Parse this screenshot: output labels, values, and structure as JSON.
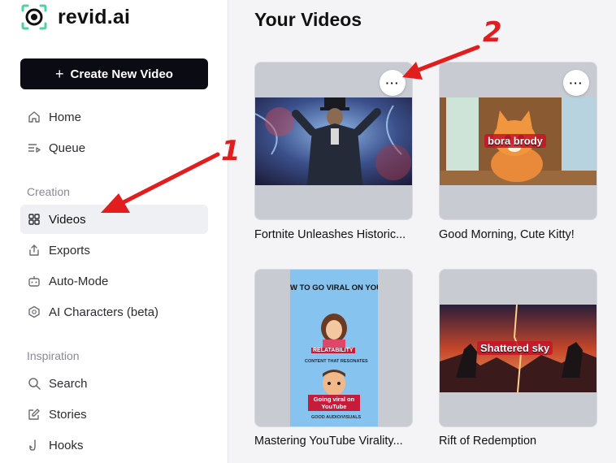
{
  "brand": {
    "name": "revid.ai"
  },
  "sidebar": {
    "create_label": "Create New Video",
    "items_top": [
      {
        "label": "Home",
        "icon": "home-icon"
      },
      {
        "label": "Queue",
        "icon": "queue-icon"
      }
    ],
    "section_creation": "Creation",
    "items_creation": [
      {
        "label": "Videos",
        "icon": "grid-icon",
        "active": true
      },
      {
        "label": "Exports",
        "icon": "export-icon"
      },
      {
        "label": "Auto-Mode",
        "icon": "robot-icon"
      },
      {
        "label": "AI Characters (beta)",
        "icon": "hexagon-icon"
      }
    ],
    "section_inspiration": "Inspiration",
    "items_inspiration": [
      {
        "label": "Search",
        "icon": "search-icon"
      },
      {
        "label": "Stories",
        "icon": "edit-icon"
      },
      {
        "label": "Hooks",
        "icon": "hook-icon"
      }
    ]
  },
  "main": {
    "title": "Your Videos",
    "videos": [
      {
        "title": "Fortnite Unleashes Historic...",
        "caption": ""
      },
      {
        "title": "Good Morning, Cute Kitty!",
        "caption": "bora brody"
      },
      {
        "title": "Mastering YouTube Virality...",
        "caption": "Going viral on YouTube",
        "thumb_header": "W TO GO VIRAL ON YOUTU",
        "thumb_label1": "RELATABILITY",
        "thumb_sub1": "CONTENT THAT RESONATES",
        "thumb_sub2": "GOOD AUDIO/VISUALS"
      },
      {
        "title": "Rift of Redemption",
        "caption": "Shattered sky"
      }
    ],
    "more_label": "···"
  },
  "annotations": {
    "one": "1",
    "two": "2",
    "arrow_color": "#e11d1d"
  }
}
